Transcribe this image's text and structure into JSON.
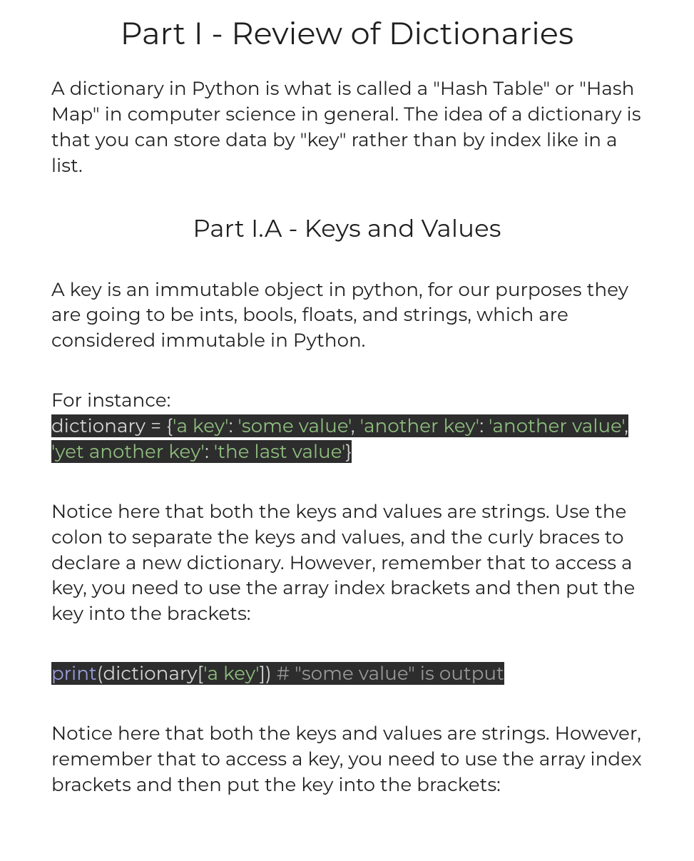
{
  "headings": {
    "h1": "Part I - Review of Dictionaries",
    "h2": "Part I.A - Keys and Values"
  },
  "paragraphs": {
    "intro": "A dictionary in Python is what is called a \"Hash Table\" or \"Hash Map\" in computer science in general.  The idea of a dictionary is that you can store data by \"key\" rather than by index like in a list.",
    "keys_values": "A key is an immutable object in python, for our purposes they are going to be ints, bools, floats, and strings, which are considered immutable in Python.",
    "for_instance_label": "For instance:",
    "after_code1": "Notice here that both the keys and values are strings.  Use the colon to separate the keys and values, and the curly braces to declare a new dictionary.  However, remember that to access a key, you need to use the array index brackets and then put the key into the brackets:",
    "after_code2": "Notice here that both the keys and values are strings.  However, remember that to access a key, you need to use the array index brackets and then put the key into the brackets:"
  },
  "code1": {
    "t1": "dictionary = {",
    "t2": "'a key'",
    "t3": ": ",
    "t4": "'some value'",
    "t5": ", ",
    "t6": "'another key'",
    "t7": ": ",
    "t8": "'another value'",
    "t9": ", ",
    "t10": "'yet another key'",
    "t11": ": ",
    "t12": "'the last value'",
    "t13": "}"
  },
  "code2": {
    "t1": "print",
    "t2": "(dictionary[",
    "t3": "'a key'",
    "t4": "]) ",
    "t5": "#  \"some value\" is output"
  }
}
